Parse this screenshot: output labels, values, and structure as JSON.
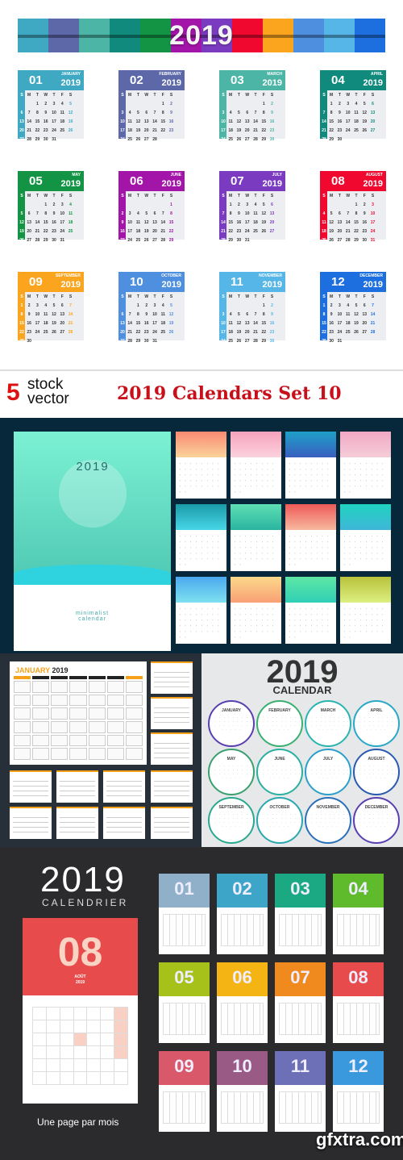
{
  "panel1": {
    "band_title": "2019",
    "band_colors": [
      "#3fa9c3",
      "#5d68a9",
      "#4cb5a6",
      "#118a7e",
      "#129444",
      "#a314a8",
      "#7b3bc1",
      "#f0082e",
      "#fba51e",
      "#4f8fe0",
      "#56b6e8",
      "#1d6fe0"
    ],
    "weekday_header": [
      "S",
      "M",
      "T",
      "W",
      "T",
      "F",
      "S"
    ],
    "year": "2019",
    "months": [
      {
        "num": "01",
        "name": "JANUARY",
        "start": 2,
        "days": 31,
        "color": "#3fa9c3"
      },
      {
        "num": "02",
        "name": "FEBRUARY",
        "start": 5,
        "days": 28,
        "color": "#5d68a9"
      },
      {
        "num": "03",
        "name": "MARCH",
        "start": 5,
        "days": 31,
        "color": "#4cb5a6"
      },
      {
        "num": "04",
        "name": "APRIL",
        "start": 1,
        "days": 30,
        "color": "#118a7e"
      },
      {
        "num": "05",
        "name": "MAY",
        "start": 3,
        "days": 31,
        "color": "#129444"
      },
      {
        "num": "06",
        "name": "JUNE",
        "start": 6,
        "days": 30,
        "color": "#a314a8"
      },
      {
        "num": "07",
        "name": "JULY",
        "start": 1,
        "days": 31,
        "color": "#7b3bc1"
      },
      {
        "num": "08",
        "name": "AUGUST",
        "start": 4,
        "days": 31,
        "color": "#f0082e"
      },
      {
        "num": "09",
        "name": "SEPTEMBER",
        "start": 0,
        "days": 30,
        "color": "#fba51e"
      },
      {
        "num": "10",
        "name": "OCTOBER",
        "start": 2,
        "days": 31,
        "color": "#4f8fe0"
      },
      {
        "num": "11",
        "name": "NOVEMBER",
        "start": 5,
        "days": 30,
        "color": "#56b6e8"
      },
      {
        "num": "12",
        "name": "DECEMBER",
        "start": 0,
        "days": 31,
        "color": "#1d6fe0"
      }
    ]
  },
  "banner": {
    "count": "5",
    "stock_line1": "stock",
    "stock_line2": "vector",
    "title": "2019 Calendars Set 10"
  },
  "panel3": {
    "cover_year": "2019",
    "cover_tagline_1": "minimalist",
    "cover_tagline_2": "calendar",
    "month_gradients": [
      [
        "#f98a72",
        "#fbd39a"
      ],
      [
        "#f7a2bc",
        "#fbd2de"
      ],
      [
        "#1ea0c8",
        "#3a5fc0"
      ],
      [
        "#f2a8c4",
        "#f5cdd8"
      ],
      [
        "#1a9aa8",
        "#47d6e6"
      ],
      [
        "#5fe0b4",
        "#2ab4a0"
      ],
      [
        "#ee5a57",
        "#f7b9a0"
      ],
      [
        "#1fd3c0",
        "#3fb6d8"
      ],
      [
        "#4aa9ee",
        "#7fe0f0"
      ],
      [
        "#fcd98a",
        "#f99f74"
      ],
      [
        "#5fe7a4",
        "#2fcfb6"
      ],
      [
        "#b8c23c",
        "#dcef80"
      ]
    ]
  },
  "panel4": {
    "title_month": "JANUARY",
    "title_year": "2019",
    "accent": "#f5a21a"
  },
  "panel5": {
    "title": "2019",
    "subtitle": "CALENDAR",
    "months": [
      "JANUARY",
      "FEBRUARY",
      "MARCH",
      "APRIL",
      "MAY",
      "JUNE",
      "JULY",
      "AUGUST",
      "SEPTEMBER",
      "OCTOBER",
      "NOVEMBER",
      "DECEMBER"
    ]
  },
  "panel6": {
    "title": "2019",
    "subtitle": "CALENDRIER",
    "featured": {
      "num": "08",
      "name": "AOÛT",
      "year": "2019"
    },
    "caption": "Une page par mois",
    "months": [
      {
        "num": "01",
        "color": "#8fb0c8"
      },
      {
        "num": "02",
        "color": "#3ca5c8"
      },
      {
        "num": "03",
        "color": "#1aa982"
      },
      {
        "num": "04",
        "color": "#5fba2c"
      },
      {
        "num": "05",
        "color": "#a6c21a"
      },
      {
        "num": "06",
        "color": "#f3b414"
      },
      {
        "num": "07",
        "color": "#f08a1e"
      },
      {
        "num": "08",
        "color": "#e84b4b"
      },
      {
        "num": "09",
        "color": "#d9596a"
      },
      {
        "num": "10",
        "color": "#9a5a86"
      },
      {
        "num": "11",
        "color": "#6d70b6"
      },
      {
        "num": "12",
        "color": "#3a98dc"
      }
    ]
  },
  "watermark": "gfxtra.com"
}
